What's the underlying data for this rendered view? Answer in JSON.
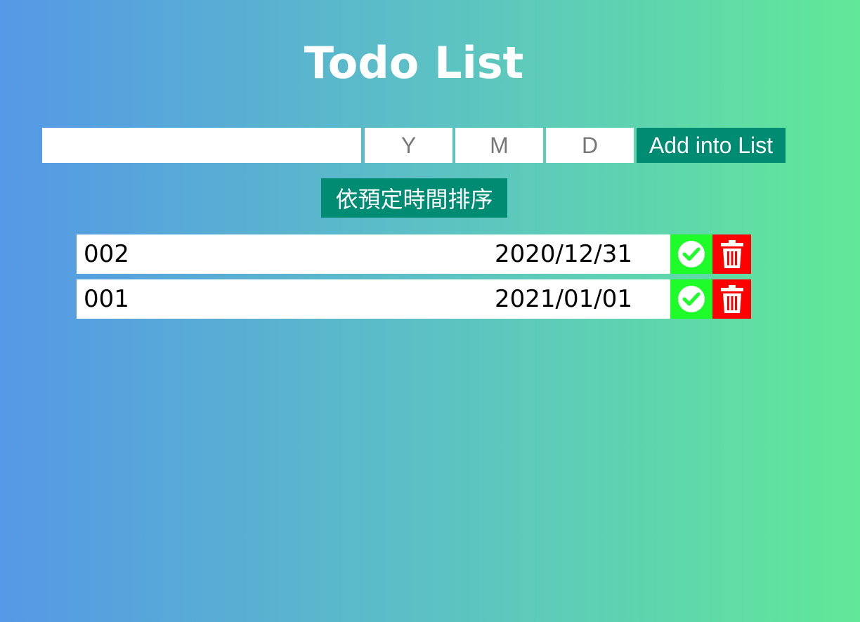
{
  "header": {
    "title": "Todo List"
  },
  "form": {
    "task_value": "",
    "year_placeholder": "Y",
    "month_placeholder": "M",
    "day_placeholder": "D",
    "add_label": "Add into List"
  },
  "sort": {
    "label": "依預定時間排序"
  },
  "todos": [
    {
      "name": "002",
      "date": "2020/12/31"
    },
    {
      "name": "001",
      "date": "2021/01/01"
    }
  ],
  "colors": {
    "gradient_start": "#5598e6",
    "gradient_end": "#61e898",
    "primary_button": "#008b73",
    "done_button": "#1efc2a",
    "delete_button": "#ff0000"
  },
  "icons": {
    "done": "check-circle-icon",
    "delete": "trash-icon"
  }
}
